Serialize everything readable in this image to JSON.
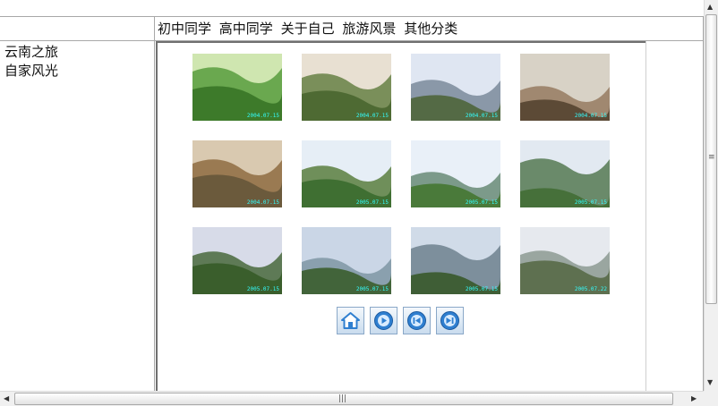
{
  "nav": {
    "links": [
      "初中同学",
      "高中同学",
      "关于自己",
      "旅游风景",
      "其他分类"
    ]
  },
  "sidebar": {
    "items": [
      "云南之旅",
      "自家风光"
    ]
  },
  "gallery": {
    "photos": [
      {
        "stamp": "2004.07.15"
      },
      {
        "stamp": "2004.07.15"
      },
      {
        "stamp": "2004.07.15"
      },
      {
        "stamp": "2004.07.15"
      },
      {
        "stamp": "2004.07.15"
      },
      {
        "stamp": "2005.07.15"
      },
      {
        "stamp": "2005.07.15"
      },
      {
        "stamp": "2005.07.15"
      },
      {
        "stamp": "2005.07.15"
      },
      {
        "stamp": "2005.07.15"
      },
      {
        "stamp": "2005.07.15"
      },
      {
        "stamp": "2005.07.22"
      }
    ]
  },
  "controls": {
    "icons": [
      "home-icon",
      "play-icon",
      "previous-icon",
      "next-icon"
    ]
  },
  "colors": {
    "grid_line": "#a8a8a8",
    "button_border": "#8aa8c8",
    "icon_blue": "#2f7fd0"
  }
}
